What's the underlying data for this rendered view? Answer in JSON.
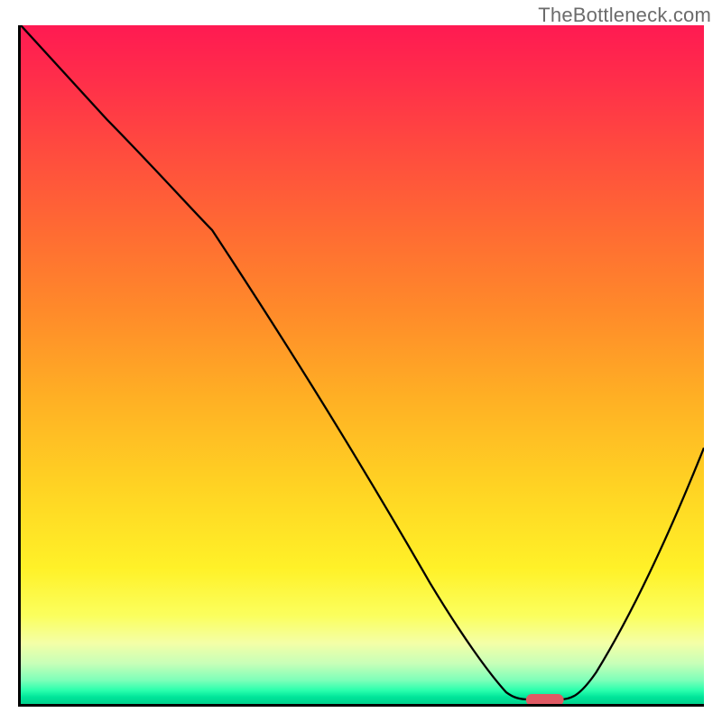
{
  "watermark": "TheBottleneck.com",
  "chart_data": {
    "type": "line",
    "title": "",
    "xlabel": "",
    "ylabel": "",
    "xlim": [
      0,
      100
    ],
    "ylim": [
      0,
      100
    ],
    "grid": false,
    "legend": false,
    "background_gradient": {
      "direction": "vertical",
      "stops": [
        {
          "pos": 0,
          "color": "#ff1a52"
        },
        {
          "pos": 0.5,
          "color": "#ffb024"
        },
        {
          "pos": 0.85,
          "color": "#fff128"
        },
        {
          "pos": 1.0,
          "color": "#00d18c"
        }
      ]
    },
    "series": [
      {
        "name": "bottleneck-curve",
        "x": [
          0,
          12,
          28,
          45,
          60,
          68,
          71,
          75,
          79,
          85,
          92,
          100
        ],
        "y": [
          100,
          86,
          70,
          43,
          18,
          4,
          1,
          0,
          0,
          7,
          21,
          38
        ]
      }
    ],
    "marker": {
      "name": "optimal-point",
      "x": 77,
      "y": 0.5,
      "shape": "pill",
      "color": "#e05a64"
    }
  }
}
